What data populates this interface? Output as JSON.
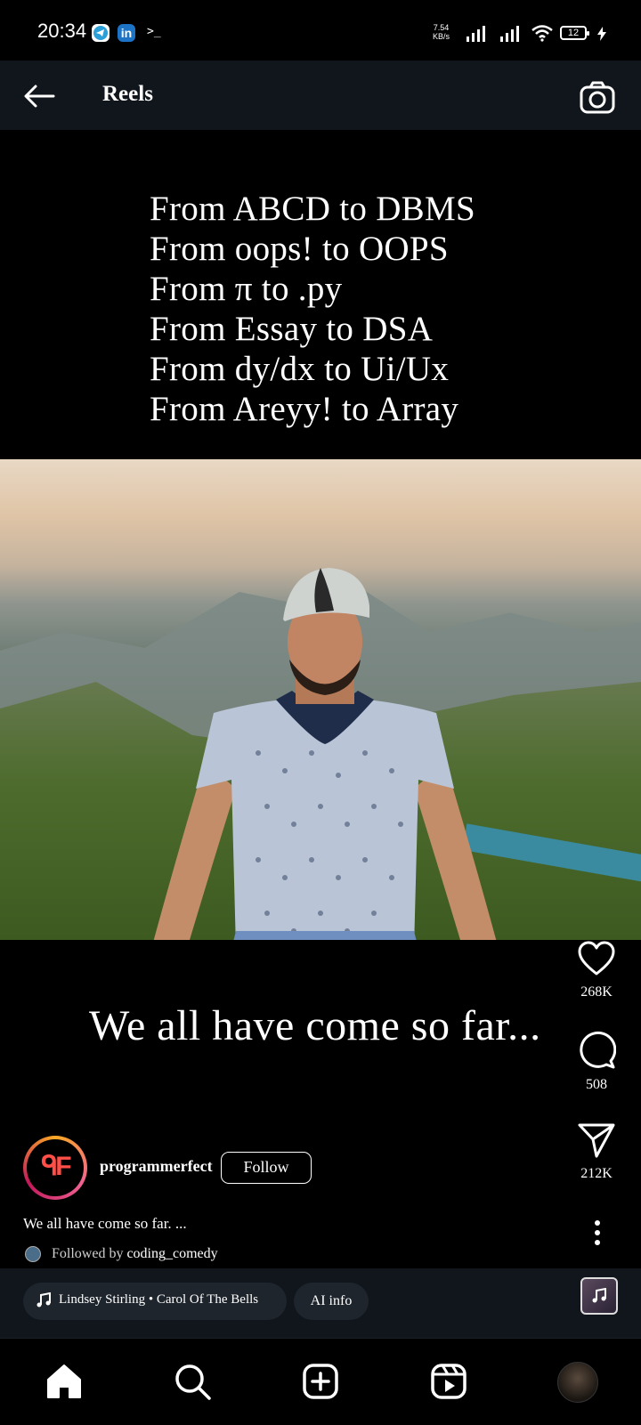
{
  "status_bar": {
    "time": "20:34",
    "terminal_glyph": ">_",
    "linkedin_label": "in",
    "net_speed_value": "7.54",
    "net_speed_unit": "KB/s",
    "battery": "12"
  },
  "header": {
    "title": "Reels",
    "back_icon": "arrow-left-icon",
    "camera_icon": "camera-icon"
  },
  "reel": {
    "poem_lines": [
      "From ABCD to DBMS",
      "From oops! to OOPS",
      "From π to .py",
      "From Essay to DSA",
      "From dy/dx to Ui/Ux",
      "From Areyy! to Array"
    ],
    "caption": "We all have come so far..."
  },
  "actions": {
    "likes": "268K",
    "comments": "508",
    "shares": "212K"
  },
  "author": {
    "username": "programmerfect",
    "avatar_text": "ᑫF",
    "follow_label": "Follow",
    "description": "We all have come so far. ...",
    "followed_by_prefix": "Followed by",
    "followed_by_user": "coding_comedy"
  },
  "music": {
    "track": "Lindsey Stirling • Carol Of The Bells",
    "ai_label": "AI info"
  },
  "nav": {
    "items": [
      "home-icon",
      "search-icon",
      "create-icon",
      "reels-icon",
      "profile-avatar"
    ]
  }
}
